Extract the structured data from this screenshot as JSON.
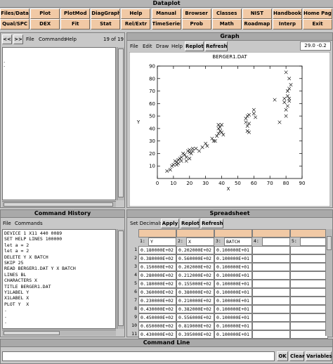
{
  "main_window": {
    "title": "Dataplot"
  },
  "toolbar_row1": [
    "Files/Data",
    "Plot",
    "PlotMod",
    "DiagGraph",
    "Help",
    "Manual",
    "Browser",
    "Classes",
    "NIST",
    "Handbook",
    "Home Page"
  ],
  "toolbar_row2": [
    "Qual/SPC",
    "DEX",
    "Fit",
    "Stat",
    "Rel/Extr",
    "TimeSeries",
    "Prob",
    "Math",
    "Roadmap",
    "Interp",
    "Exit"
  ],
  "text_panel": {
    "back_button": "<<",
    "forward_button": ">>",
    "menu": [
      "File",
      "Commands",
      "Help"
    ],
    "page_counter": "19 of 19"
  },
  "graph_window": {
    "title": "Graph",
    "menu": [
      "File",
      "Edit",
      "Draw",
      "Help"
    ],
    "replot_button": "Replot",
    "refresh_button": "Refresh",
    "coord_readout": "29.0  -0.2"
  },
  "chart_data": {
    "type": "scatter",
    "title": "BERGER1.DAT",
    "xlabel": "X",
    "ylabel": "Y",
    "xlim": [
      0,
      90
    ],
    "ylim": [
      0,
      90
    ],
    "xticks": [
      "0",
      "10",
      "20",
      "30",
      "40",
      "50",
      "60",
      "70",
      "80",
      "90"
    ],
    "yticks": [
      "10",
      "20",
      "30",
      "40",
      "50",
      "60",
      "70",
      "80",
      "90"
    ],
    "marker": "X",
    "grid": false,
    "points": [
      [
        6,
        6
      ],
      [
        8,
        7
      ],
      [
        9,
        10
      ],
      [
        10,
        11
      ],
      [
        11,
        14
      ],
      [
        12,
        13
      ],
      [
        12,
        11
      ],
      [
        13,
        12
      ],
      [
        13,
        15
      ],
      [
        14,
        16
      ],
      [
        15,
        14
      ],
      [
        15,
        17
      ],
      [
        16,
        20
      ],
      [
        17,
        19
      ],
      [
        18,
        14
      ],
      [
        18,
        17
      ],
      [
        19,
        22
      ],
      [
        20,
        21
      ],
      [
        20,
        23
      ],
      [
        20,
        16
      ],
      [
        21,
        20
      ],
      [
        22,
        22
      ],
      [
        22,
        24
      ],
      [
        24,
        24
      ],
      [
        26,
        22
      ],
      [
        28,
        25
      ],
      [
        30,
        28
      ],
      [
        31,
        26
      ],
      [
        34,
        32
      ],
      [
        35,
        30
      ],
      [
        36,
        30
      ],
      [
        37,
        34
      ],
      [
        38,
        36
      ],
      [
        38,
        40
      ],
      [
        38,
        43
      ],
      [
        39,
        41
      ],
      [
        39,
        38
      ],
      [
        40,
        37
      ],
      [
        40,
        43
      ],
      [
        41,
        35
      ],
      [
        55,
        45
      ],
      [
        55,
        48
      ],
      [
        56,
        42
      ],
      [
        56,
        50
      ],
      [
        56,
        38
      ],
      [
        57,
        44
      ],
      [
        57,
        51
      ],
      [
        57,
        37
      ],
      [
        60,
        52
      ],
      [
        60,
        55
      ],
      [
        61,
        49
      ],
      [
        73,
        63
      ],
      [
        76,
        45
      ],
      [
        79,
        61
      ],
      [
        79,
        64
      ],
      [
        80,
        85
      ],
      [
        80,
        55
      ],
      [
        80,
        50
      ],
      [
        81,
        66
      ],
      [
        81,
        70
      ],
      [
        81,
        58
      ],
      [
        82,
        64
      ],
      [
        82,
        72
      ],
      [
        82,
        62
      ],
      [
        82,
        80
      ],
      [
        83,
        75
      ]
    ]
  },
  "command_history": {
    "title": "Command History",
    "menu": [
      "File",
      "Commands"
    ],
    "lines": [
      "DEVICE 1 X11 440 0089",
      "SET HELP LINES 100000",
      "let a = 2",
      "let a = 2",
      "DELETE Y X BATCH",
      "SKIP 25",
      "READ BERGER1.DAT Y X BATCH",
      "LINES BL",
      "CHARACTERS X",
      "TITLE BERGER1.DAT",
      "Y1LABEL Y",
      "X1LABEL X",
      "PLOT Y  X",
      ".",
      ".",
      "."
    ]
  },
  "spreadsheet": {
    "title": "Spreadsheet",
    "set_decimals_label": "Set Decimals",
    "apply_button": "Apply",
    "replot_button": "Replot",
    "refresh_button": "Refresh",
    "col_numbers": [
      "1:",
      "2:",
      "3:",
      "4:",
      "5:"
    ],
    "col_names": [
      "Y",
      "X",
      "BATCH",
      "",
      ""
    ],
    "rows": [
      {
        "n": "1",
        "cells": [
          "0.180000E+02",
          "0.202000E+02",
          "0.100000E+01"
        ]
      },
      {
        "n": "2",
        "cells": [
          "0.380000E+02",
          "0.560000E+02",
          "0.100000E+01"
        ]
      },
      {
        "n": "3",
        "cells": [
          "0.150000E+02",
          "0.202000E+02",
          "0.100000E+01"
        ]
      },
      {
        "n": "4",
        "cells": [
          "0.280000E+02",
          "0.212000E+02",
          "0.100000E+01"
        ]
      },
      {
        "n": "5",
        "cells": [
          "0.180000E+02",
          "0.155000E+02",
          "0.100000E+01"
        ]
      },
      {
        "n": "6",
        "cells": [
          "0.360000E+02",
          "0.380000E+02",
          "0.100000E+01"
        ]
      },
      {
        "n": "7",
        "cells": [
          "0.230000E+02",
          "0.210000E+02",
          "0.100000E+01"
        ]
      },
      {
        "n": "8",
        "cells": [
          "0.430000E+02",
          "0.382000E+02",
          "0.100000E+01"
        ]
      },
      {
        "n": "9",
        "cells": [
          "0.450000E+02",
          "0.556000E+02",
          "0.100000E+01"
        ]
      },
      {
        "n": "10",
        "cells": [
          "0.650000E+02",
          "0.819000E+02",
          "0.100000E+01"
        ]
      },
      {
        "n": "11",
        "cells": [
          "0.430000E+02",
          "0.395000E+02",
          "0.100000E+01"
        ]
      }
    ]
  },
  "command_line": {
    "title": "Command Line",
    "value": "",
    "ok_button": "OK",
    "clear_button": "Clear",
    "variables_button": "Variables"
  },
  "colors": {
    "button_face": "#f1c9a5",
    "panel": "#c8c8c8",
    "title_bar": "#b4b4b4"
  }
}
